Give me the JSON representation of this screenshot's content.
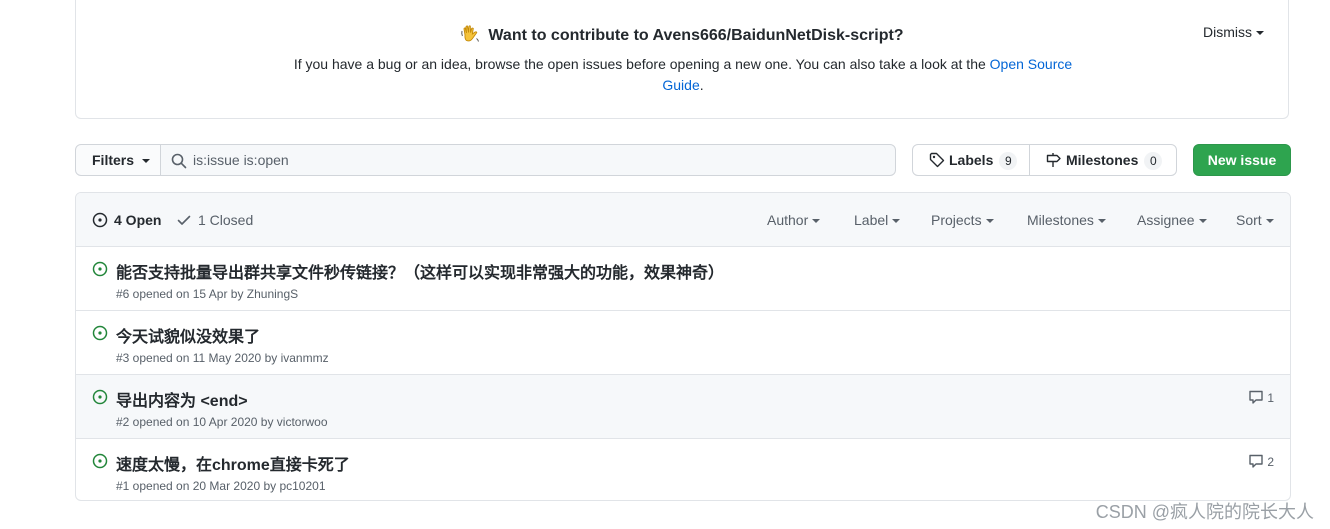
{
  "banner": {
    "title": "Want to contribute to Avens666/BaidunNetDisk-script?",
    "text_before_link": "If you have a bug or an idea, browse the open issues before opening a new one. You can also take a look at the ",
    "link_text": "Open Source Guide",
    "text_after_link": ".",
    "dismiss_label": "Dismiss"
  },
  "toolbar": {
    "filters_label": "Filters",
    "search_value": "is:issue is:open",
    "labels_label": "Labels",
    "labels_count": "9",
    "milestones_label": "Milestones",
    "milestones_count": "0",
    "new_issue_label": "New issue"
  },
  "issues_header": {
    "open_label": "4 Open",
    "closed_label": "1 Closed",
    "filters": [
      "Author",
      "Label",
      "Projects",
      "Milestones",
      "Assignee",
      "Sort"
    ]
  },
  "issues": [
    {
      "title": "能否支持批量导出群共享文件秒传链接？（这样可以实现非常强大的功能，效果神奇）",
      "meta": "#6 opened on 15 Apr by ZhuningS",
      "comments": ""
    },
    {
      "title": "今天试貌似没效果了",
      "meta": "#3 opened on 11 May 2020 by ivanmmz",
      "comments": ""
    },
    {
      "title": "导出内容为 <end>",
      "meta": "#2 opened on 10 Apr 2020 by victorwoo",
      "comments": "1"
    },
    {
      "title": "速度太慢，在chrome直接卡死了",
      "meta": "#1 opened on 20 Mar 2020 by pc10201",
      "comments": "2"
    }
  ],
  "watermark": "CSDN @疯人院的院长大人",
  "colors": {
    "accent_green": "#2ea44f",
    "open_icon_green": "#22863a",
    "link_blue": "#0366d6",
    "border": "#e1e4e8",
    "header_bg": "#f6f8fa"
  }
}
